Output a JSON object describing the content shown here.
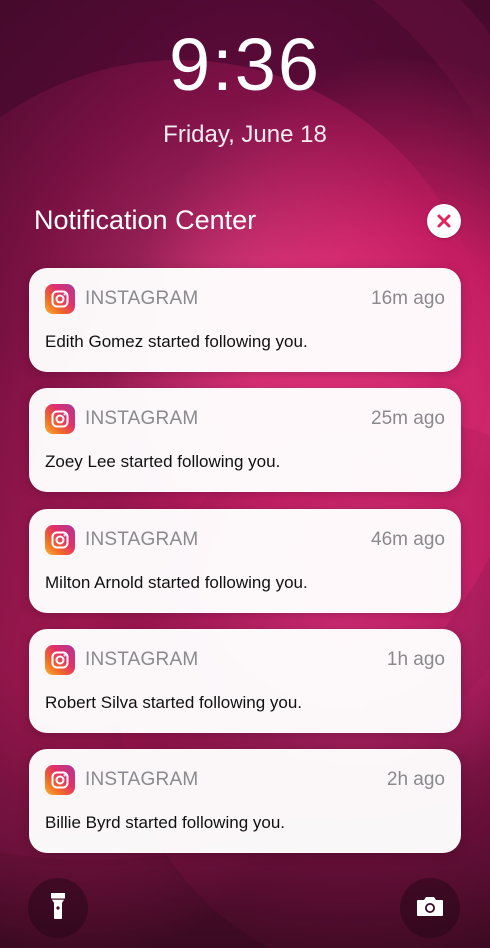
{
  "lockscreen": {
    "time": "9:36",
    "date": "Friday, June 18"
  },
  "notification_center": {
    "title": "Notification Center",
    "close_icon": "close-x-icon"
  },
  "notifications": [
    {
      "app": "INSTAGRAM",
      "time": "16m ago",
      "message": "Edith Gomez started following you.",
      "icon": "instagram-icon"
    },
    {
      "app": "INSTAGRAM",
      "time": "25m ago",
      "message": "Zoey Lee started following you.",
      "icon": "instagram-icon"
    },
    {
      "app": "INSTAGRAM",
      "time": "46m ago",
      "message": "Milton Arnold started following you.",
      "icon": "instagram-icon"
    },
    {
      "app": "INSTAGRAM",
      "time": "1h ago",
      "message": "Robert Silva started following you.",
      "icon": "instagram-icon"
    },
    {
      "app": "INSTAGRAM",
      "time": "2h ago",
      "message": "Billie Byrd started following you.",
      "icon": "instagram-icon"
    }
  ],
  "bottom_controls": {
    "left_icon": "flashlight-icon",
    "right_icon": "camera-icon"
  },
  "colors": {
    "wallpaper_primary": "#c21c60",
    "wallpaper_dark": "#3a0a26",
    "card_background": "#ffffff",
    "secondary_text": "#8a8a8e"
  }
}
